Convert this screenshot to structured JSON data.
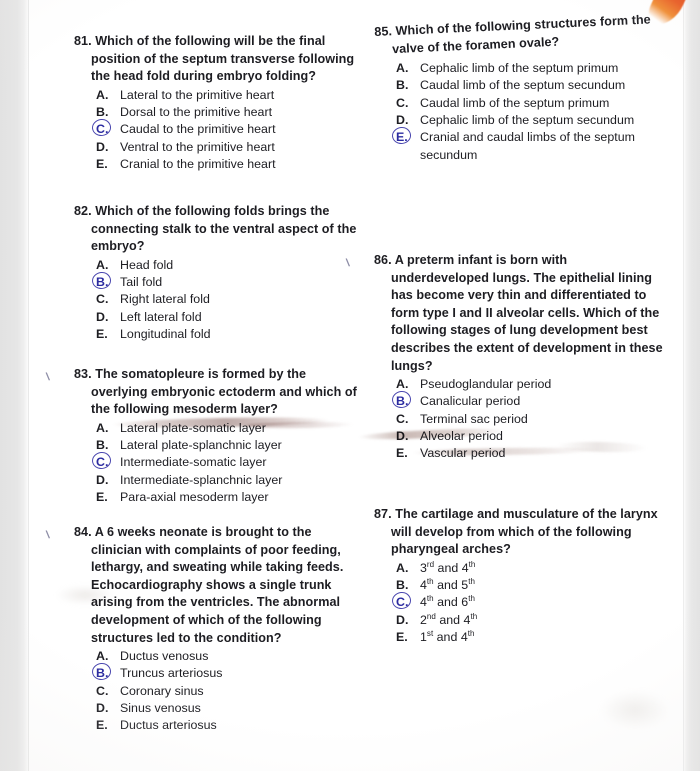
{
  "page": {
    "background_color": "#ffffff",
    "ink_color": "#1d1d22",
    "answer_mark_color": "#3b37a8",
    "corner_mark_color": "#d93b0e"
  },
  "columns": {
    "left": [
      {
        "number": "81.",
        "tick": "",
        "stem": "Which of the following will be the final position of the septum transverse following the head fold during embryo folding?",
        "options": [
          {
            "letter": "A.",
            "text": "Lateral  to the primitive heart",
            "circled": false
          },
          {
            "letter": "B.",
            "text": "Dorsal  to the primitive heart",
            "circled": false
          },
          {
            "letter": "C.",
            "text": "Caudal  to the primitive heart",
            "circled": true
          },
          {
            "letter": "D.",
            "text": "Ventral  to the primitive heart",
            "circled": false
          },
          {
            "letter": "E.",
            "text": "Cranial  to the primitive heart",
            "circled": false
          }
        ]
      },
      {
        "number": "82.",
        "tick": "",
        "stem": "Which of the following folds brings the connecting stalk to the ventral aspect of the embryo?",
        "options": [
          {
            "letter": "A.",
            "text": "Head fold",
            "circled": false
          },
          {
            "letter": "B.",
            "text": "Tail fold",
            "circled": true
          },
          {
            "letter": "C.",
            "text": "Right lateral fold",
            "circled": false
          },
          {
            "letter": "D.",
            "text": "Left lateral fold",
            "circled": false
          },
          {
            "letter": "E.",
            "text": "Longitudinal fold",
            "circled": false
          }
        ]
      },
      {
        "number": "83.",
        "tick": "\\",
        "stem": "The somatopleure is formed by the overlying embryonic ectoderm and which of the following mesoderm layer?",
        "options": [
          {
            "letter": "A.",
            "text": "Lateral plate-somatic layer",
            "circled": false
          },
          {
            "letter": "B.",
            "text": "Lateral plate-splanchnic layer",
            "circled": false
          },
          {
            "letter": "C.",
            "text": "Intermediate-somatic layer",
            "circled": true
          },
          {
            "letter": "D.",
            "text": "Intermediate-splanchnic layer",
            "circled": false
          },
          {
            "letter": "E.",
            "text": "Para-axial mesoderm layer",
            "circled": false
          }
        ]
      },
      {
        "number": "84.",
        "tick": "\\",
        "stem": "A 6 weeks neonate is brought to the clinician with complaints of poor feeding, lethargy, and sweating while taking feeds. Echocardiography shows a single trunk arising from the ventricles. The abnormal development of which of the following structures led to the condition?",
        "options": [
          {
            "letter": "A.",
            "text": "Ductus venosus",
            "circled": false
          },
          {
            "letter": "B.",
            "text": "Truncus arteriosus",
            "circled": true
          },
          {
            "letter": "C.",
            "text": "Coronary sinus",
            "circled": false
          },
          {
            "letter": "D.",
            "text": "Sinus venosus",
            "circled": false
          },
          {
            "letter": "E.",
            "text": "Ductus arteriosus",
            "circled": false
          }
        ]
      }
    ],
    "right": [
      {
        "number": "85.",
        "tick": "",
        "stem": "Which of the following structures form the valve of the foramen ovale?",
        "options": [
          {
            "letter": "A.",
            "text": "Cephalic limb of the septum primum",
            "circled": false
          },
          {
            "letter": "B.",
            "text": "Caudal limb of the septum secundum",
            "circled": false
          },
          {
            "letter": "C.",
            "text": "Caudal limb of the septum primum",
            "circled": false
          },
          {
            "letter": "D.",
            "text": "Cephalic limb of the septum secundum",
            "circled": false
          },
          {
            "letter": "E.",
            "text": "Cranial and caudal limbs of the septum secundum",
            "circled": true
          }
        ]
      },
      {
        "number": "86.",
        "tick": "\\",
        "stem": "A preterm infant is born with underdeveloped lungs. The epithelial lining has become very thin and differentiated to form type I and II alveolar cells. Which of the following stages of lung development best describes the extent of development in these lungs?",
        "options": [
          {
            "letter": "A.",
            "text": "Pseudoglandular period",
            "circled": false
          },
          {
            "letter": "B.",
            "text": "Canalicular period",
            "circled": true
          },
          {
            "letter": "C.",
            "text": "Terminal sac period",
            "circled": false
          },
          {
            "letter": "D.",
            "text": "Alveolar period",
            "circled": false
          },
          {
            "letter": "E.",
            "text": "Vascular period",
            "circled": false
          }
        ]
      },
      {
        "number": "87.",
        "tick": "",
        "stem": "The cartilage and musculature of the larynx will develop from which of the following pharyngeal arches?",
        "options": [
          {
            "letter": "A.",
            "text": "3<sup>rd</sup> and 4<sup>th</sup>",
            "circled": false
          },
          {
            "letter": "B.",
            "text": "4<sup>th</sup> and 5<sup>th</sup>",
            "circled": false
          },
          {
            "letter": "C.",
            "text": "4<sup>th</sup> and 6<sup>th</sup>",
            "circled": true
          },
          {
            "letter": "D.",
            "text": "2<sup>nd</sup> and 4<sup>th</sup>",
            "circled": false
          },
          {
            "letter": "E.",
            "text": "1<sup>st</sup> and 4<sup>th</sup>",
            "circled": false
          }
        ]
      }
    ]
  }
}
